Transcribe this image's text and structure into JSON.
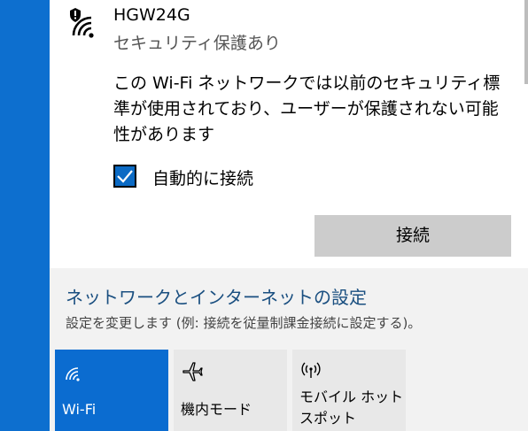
{
  "network": {
    "ssid": "HGW24G",
    "security_status": "セキュリティ保護あり",
    "warning": "この Wi-Fi ネットワークでは以前のセキュリティ標準が使用されており、ユーザーが保護されない可能性があります",
    "auto_connect_label": "自動的に接続",
    "auto_connect_checked": true,
    "connect_label": "接続"
  },
  "settings": {
    "title": "ネットワークとインターネットの設定",
    "description": "設定を変更します (例: 接続を従量制課金接続に設定する)。"
  },
  "quick_actions": [
    {
      "label": "Wi-Fi",
      "icon": "wifi-icon",
      "active": true
    },
    {
      "label": "機内モード",
      "icon": "airplane-icon",
      "active": false
    },
    {
      "label": "モバイル ホットスポット",
      "icon": "hotspot-icon",
      "active": false
    }
  ],
  "colors": {
    "accent": "#0b6cd0",
    "taskbar_background": "#0d6fcf",
    "link": "#1a4f80",
    "button": "#cccccc"
  }
}
